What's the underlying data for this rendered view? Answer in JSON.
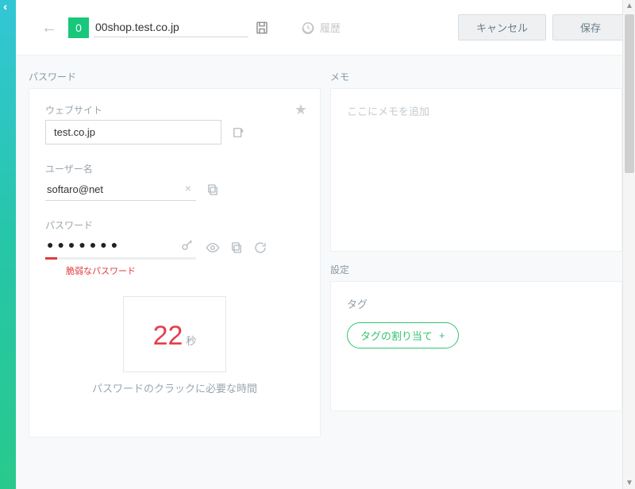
{
  "header": {
    "badge_letter": "0",
    "title_value": "00shop.test.co.jp",
    "history_label": "履歴",
    "cancel_label": "キャンセル",
    "save_label": "保存"
  },
  "icons": {
    "back": "back-arrow-icon",
    "disk": "save-disk-icon",
    "history": "history-icon",
    "star": "star-icon",
    "open_external": "open-external-icon",
    "clear": "clear-icon",
    "copy": "copy-icon",
    "key": "key-icon",
    "eye": "reveal-icon",
    "refresh": "regenerate-icon"
  },
  "password_section": {
    "section_label": "パスワード",
    "website_label": "ウェブサイト",
    "website_value": "test.co.jp",
    "username_label": "ユーザー名",
    "username_value": "softaro@net",
    "password_label": "パスワード",
    "password_masked": "●●●●●●●",
    "strength_text": "脆弱なパスワード",
    "crack_number": "22",
    "crack_unit": "秒",
    "crack_caption": "パスワードのクラックに必要な時間"
  },
  "memo_section": {
    "section_label": "メモ",
    "placeholder": "ここにメモを追加"
  },
  "settings_section": {
    "section_label": "設定",
    "tag_label": "タグ",
    "assign_tag_label": "タグの割り当て",
    "assign_tag_plus": "+"
  }
}
